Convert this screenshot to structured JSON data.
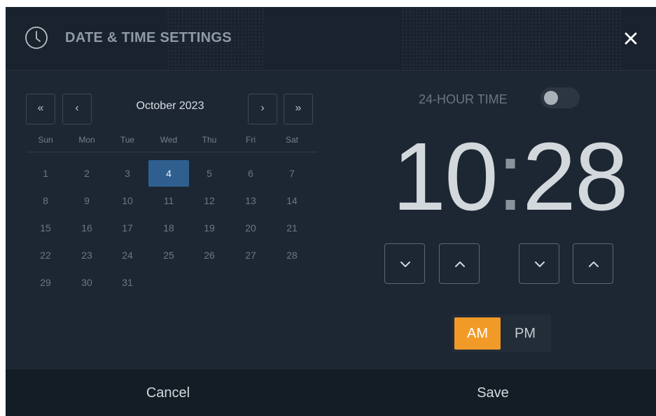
{
  "header": {
    "title": "DATE & TIME SETTINGS",
    "icon": "clock-icon",
    "close_icon": "close-icon"
  },
  "calendar": {
    "nav": {
      "prev_year": "«",
      "prev_month": "‹",
      "next_month": "›",
      "next_year": "»"
    },
    "month_label": "October 2023",
    "weekdays": [
      "Sun",
      "Mon",
      "Tue",
      "Wed",
      "Thu",
      "Fri",
      "Sat"
    ],
    "weeks": [
      [
        "1",
        "2",
        "3",
        "4",
        "5",
        "6",
        "7"
      ],
      [
        "8",
        "9",
        "10",
        "11",
        "12",
        "13",
        "14"
      ],
      [
        "15",
        "16",
        "17",
        "18",
        "19",
        "20",
        "21"
      ],
      [
        "22",
        "23",
        "24",
        "25",
        "26",
        "27",
        "28"
      ],
      [
        "29",
        "30",
        "31"
      ]
    ],
    "selected_day": "4"
  },
  "time": {
    "toggle_label": "24-HOUR TIME",
    "toggle_on": false,
    "hours": "10",
    "separator": ":",
    "minutes": "28",
    "am_label": "AM",
    "pm_label": "PM",
    "period_selected": "AM"
  },
  "footer": {
    "cancel_label": "Cancel",
    "save_label": "Save"
  },
  "colors": {
    "background": "#1c2733",
    "selected_day": "#2f5f8f",
    "accent": "#f29a28"
  }
}
